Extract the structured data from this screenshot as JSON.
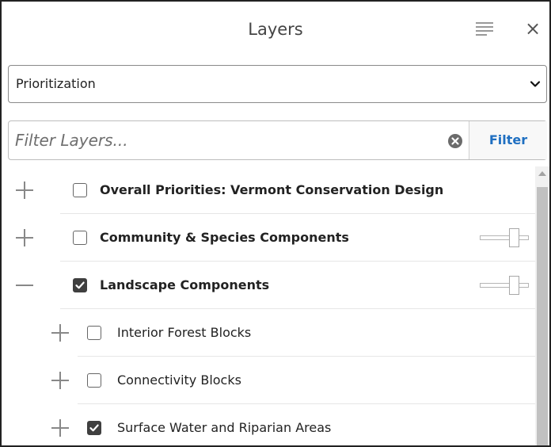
{
  "header": {
    "title": "Layers",
    "menu_icon": "hamburger-menu-icon",
    "close_glyph": "×"
  },
  "dropdown": {
    "selected": "Prioritization"
  },
  "filter": {
    "placeholder": "Filter Layers...",
    "value": "",
    "button_label": "Filter"
  },
  "layers": [
    {
      "label": "Overall Priorities: Vermont Conservation Design",
      "expanded": false,
      "checked": false,
      "bold": true,
      "level": 0,
      "has_slider": false
    },
    {
      "label": "Community & Species Components",
      "expanded": false,
      "checked": false,
      "bold": true,
      "level": 0,
      "has_slider": true,
      "opacity": 0.75
    },
    {
      "label": "Landscape Components",
      "expanded": true,
      "checked": true,
      "bold": true,
      "level": 0,
      "has_slider": true,
      "opacity": 0.75
    },
    {
      "label": "Interior Forest Blocks",
      "expanded": false,
      "checked": false,
      "bold": false,
      "level": 1,
      "has_slider": false
    },
    {
      "label": "Connectivity Blocks",
      "expanded": false,
      "checked": false,
      "bold": false,
      "level": 1,
      "has_slider": false
    },
    {
      "label": "Surface Water and Riparian Areas",
      "expanded": false,
      "checked": true,
      "bold": false,
      "level": 1,
      "has_slider": false
    }
  ],
  "colors": {
    "accent": "#1f6fc1",
    "checkbox_checked": "#3f3f3f"
  }
}
